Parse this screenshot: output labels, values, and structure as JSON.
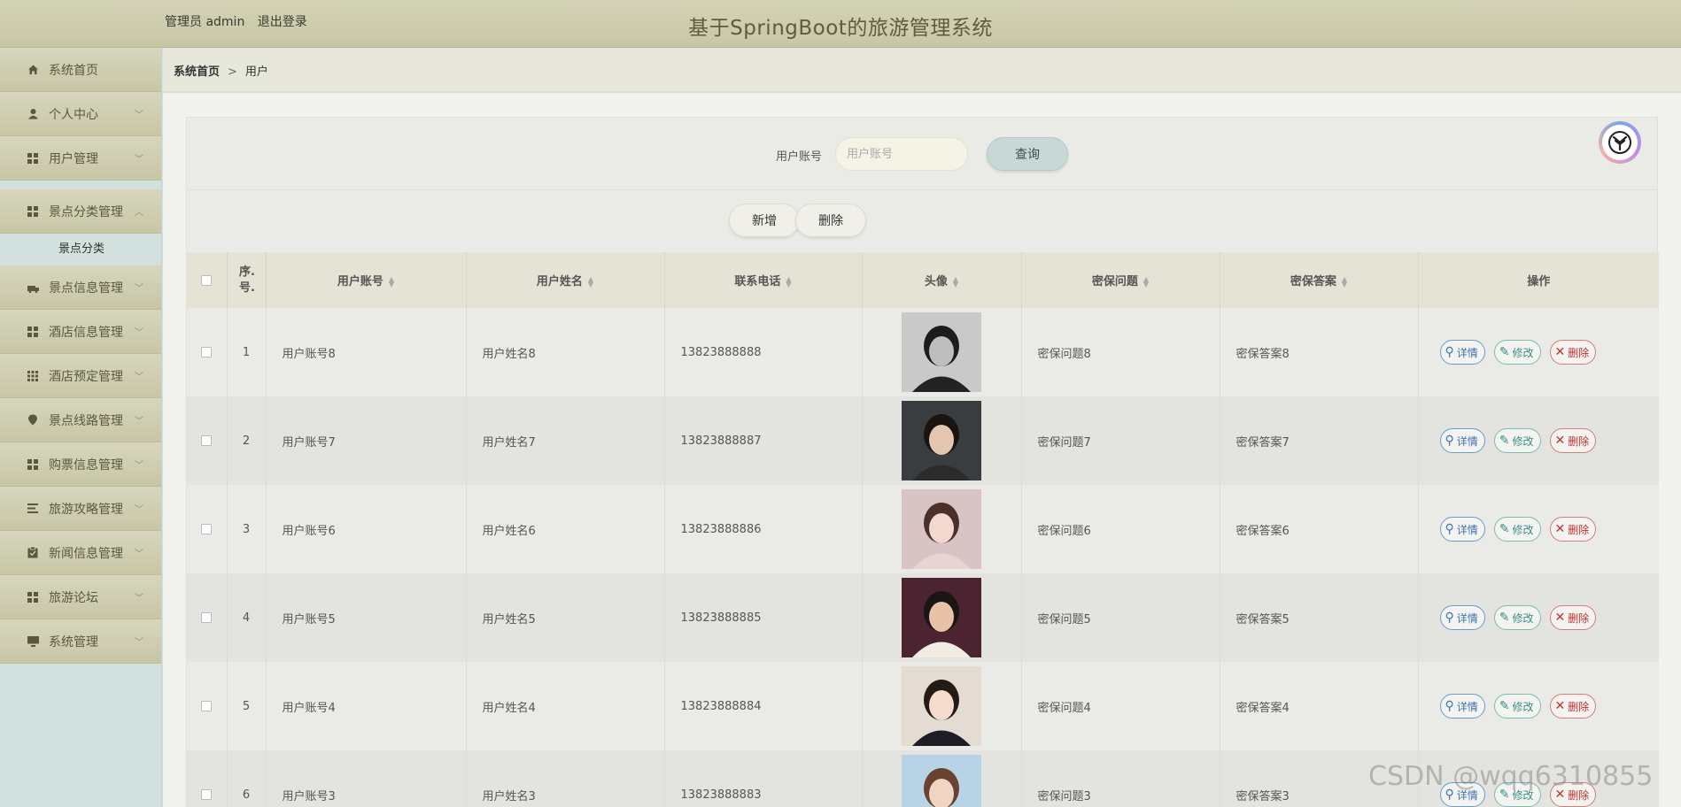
{
  "header": {
    "user_label": "管理员 admin",
    "logout_label": "退出登录",
    "title": "基于SpringBoot的旅游管理系统"
  },
  "sidebar": {
    "items": [
      {
        "label": "系统首页",
        "icon": "home-icon",
        "has_chevron": false
      },
      {
        "label": "个人中心",
        "icon": "person-icon",
        "has_chevron": true
      },
      {
        "label": "用户管理",
        "icon": "grid-icon",
        "has_chevron": true
      },
      {
        "label": "景点分类管理",
        "icon": "grid-icon",
        "has_chevron": true,
        "expanded": true
      },
      {
        "label": "景点信息管理",
        "icon": "truck-icon",
        "has_chevron": true
      },
      {
        "label": "酒店信息管理",
        "icon": "grid-icon",
        "has_chevron": true
      },
      {
        "label": "酒店预定管理",
        "icon": "apps-icon",
        "has_chevron": true
      },
      {
        "label": "景点线路管理",
        "icon": "pin-icon",
        "has_chevron": true
      },
      {
        "label": "购票信息管理",
        "icon": "grid-icon",
        "has_chevron": true
      },
      {
        "label": "旅游攻略管理",
        "icon": "list-icon",
        "has_chevron": true
      },
      {
        "label": "新闻信息管理",
        "icon": "clipboard-icon",
        "has_chevron": true
      },
      {
        "label": "旅游论坛",
        "icon": "grid-icon",
        "has_chevron": true
      },
      {
        "label": "系统管理",
        "icon": "monitor-icon",
        "has_chevron": true
      }
    ],
    "sub_item": "景点分类"
  },
  "breadcrumb": {
    "home": "系统首页",
    "separator": ">",
    "current": "用户"
  },
  "search": {
    "label": "用户账号",
    "placeholder": "用户账号",
    "button": "查询"
  },
  "actions": {
    "add": "新增",
    "delete": "删除"
  },
  "table": {
    "columns": [
      "序号",
      "用户账号",
      "用户姓名",
      "联系电话",
      "头像",
      "密保问题",
      "密保答案",
      "操作"
    ],
    "index_header": "序.号.",
    "rows": [
      {
        "no": "1",
        "account": "用户账号8",
        "name": "用户姓名8",
        "phone": "13823888888",
        "question": "密保问题8",
        "answer": "密保答案8"
      },
      {
        "no": "2",
        "account": "用户账号7",
        "name": "用户姓名7",
        "phone": "13823888887",
        "question": "密保问题7",
        "answer": "密保答案7"
      },
      {
        "no": "3",
        "account": "用户账号6",
        "name": "用户姓名6",
        "phone": "13823888886",
        "question": "密保问题6",
        "answer": "密保答案6"
      },
      {
        "no": "4",
        "account": "用户账号5",
        "name": "用户姓名5",
        "phone": "13823888885",
        "question": "密保问题5",
        "answer": "密保答案5"
      },
      {
        "no": "5",
        "account": "用户账号4",
        "name": "用户姓名4",
        "phone": "13823888884",
        "question": "密保问题4",
        "answer": "密保答案4"
      },
      {
        "no": "6",
        "account": "用户账号3",
        "name": "用户姓名3",
        "phone": "13823888883",
        "question": "密保问题3",
        "answer": "密保答案3"
      }
    ],
    "ops": {
      "detail": "详情",
      "edit": "修改",
      "delete": "删除"
    }
  },
  "colors": {
    "header_bg": "#c9c8a8",
    "sidebar_bg": "#d2e0de",
    "detail": "#3f73b6",
    "edit": "#3a8f88",
    "delete": "#c13030"
  },
  "watermark": "CSDN @wqq6310855"
}
